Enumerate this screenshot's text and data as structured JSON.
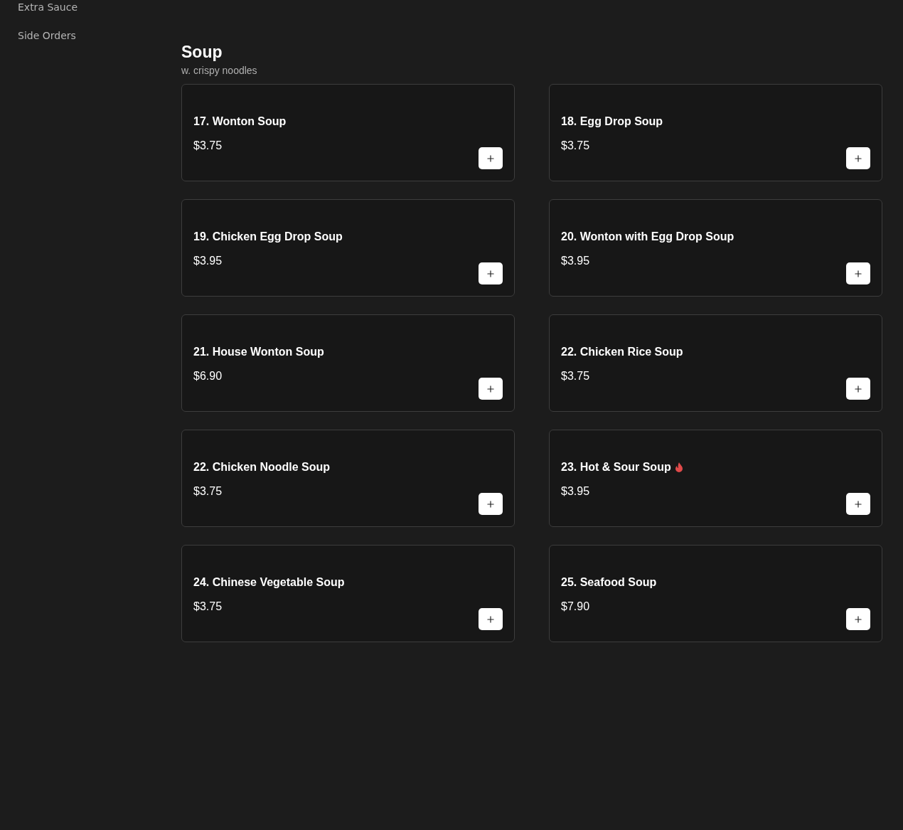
{
  "sidebar": {
    "items": [
      {
        "label": "Extra Sauce"
      },
      {
        "label": "Side Orders"
      }
    ]
  },
  "section": {
    "title": "Soup",
    "subtitle": "w. crispy noodles",
    "items": [
      {
        "name": "17. Wonton Soup",
        "price": "$3.75",
        "spicy": false
      },
      {
        "name": "18. Egg Drop Soup",
        "price": "$3.75",
        "spicy": false
      },
      {
        "name": "19. Chicken Egg Drop Soup",
        "price": "$3.95",
        "spicy": false
      },
      {
        "name": "20. Wonton with Egg Drop Soup",
        "price": "$3.95",
        "spicy": false
      },
      {
        "name": "21. House Wonton Soup",
        "price": "$6.90",
        "spicy": false
      },
      {
        "name": "22. Chicken Rice Soup",
        "price": "$3.75",
        "spicy": false
      },
      {
        "name": "22. Chicken Noodle Soup",
        "price": "$3.75",
        "spicy": false
      },
      {
        "name": "23. Hot & Sour Soup",
        "price": "$3.95",
        "spicy": true
      },
      {
        "name": "24. Chinese Vegetable Soup",
        "price": "$3.75",
        "spicy": false
      },
      {
        "name": "25. Seafood Soup",
        "price": "$7.90",
        "spicy": false
      }
    ]
  }
}
